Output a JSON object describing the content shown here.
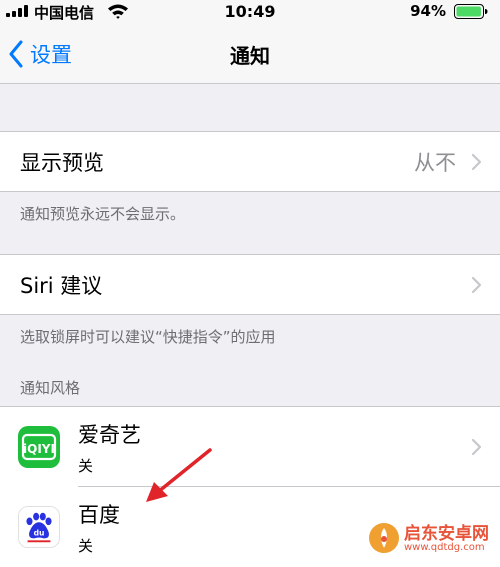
{
  "status_bar": {
    "carrier": "中国电信",
    "time": "10:49",
    "battery": "94%",
    "battery_level": 0.94
  },
  "nav": {
    "back_label": "设置",
    "title": "通知"
  },
  "preview": {
    "label": "显示预览",
    "value": "从不",
    "footer": "通知预览永远不会显示。"
  },
  "siri": {
    "label": "Siri 建议",
    "footer": "选取锁屏时可以建议“快捷指令”的应用"
  },
  "notification_style": {
    "header": "通知风格",
    "apps": [
      {
        "name": "爱奇艺",
        "status": "关",
        "icon": "iqiyi-icon"
      },
      {
        "name": "百度",
        "status": "关",
        "icon": "baidu-icon"
      }
    ]
  },
  "watermark": {
    "name": "启东安卓网",
    "url": "www.qdtdg.com"
  },
  "colors": {
    "ios_blue": "#007aff",
    "background": "#efeff4",
    "iqiyi_green": "#1ebe3c",
    "baidu_blue": "#2932e1",
    "arrow_red": "#e0242a"
  }
}
